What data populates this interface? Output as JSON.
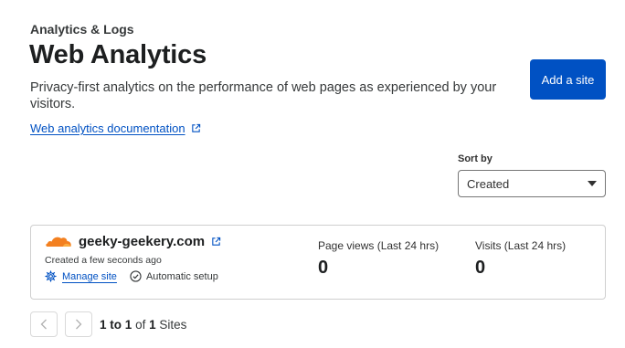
{
  "header": {
    "breadcrumb": "Analytics & Logs",
    "title": "Web Analytics",
    "description": "Privacy-first analytics on the performance of web pages as experienced by your visitors.",
    "doc_link": "Web analytics documentation",
    "add_site_label": "Add a site"
  },
  "sort": {
    "label": "Sort by",
    "selected": "Created"
  },
  "sites": [
    {
      "name": "geeky-geekery.com",
      "created": "Created a few seconds ago",
      "manage_label": "Manage site",
      "setup_label": "Automatic setup",
      "pageviews_label": "Page views (Last 24 hrs)",
      "pageviews_value": "0",
      "visits_label": "Visits (Last 24 hrs)",
      "visits_value": "0"
    }
  ],
  "pagination": {
    "range_start": "1",
    "to_text": "to",
    "range_end": "1",
    "of_text": "of",
    "total": "1",
    "unit": "Sites"
  },
  "colors": {
    "accent": "#0051c3",
    "cloudflare_orange": "#f38020"
  },
  "icons": [
    "external-link-icon",
    "cloud-logo-icon",
    "gear-icon",
    "check-circle-icon",
    "chevron-left-icon",
    "chevron-right-icon"
  ]
}
